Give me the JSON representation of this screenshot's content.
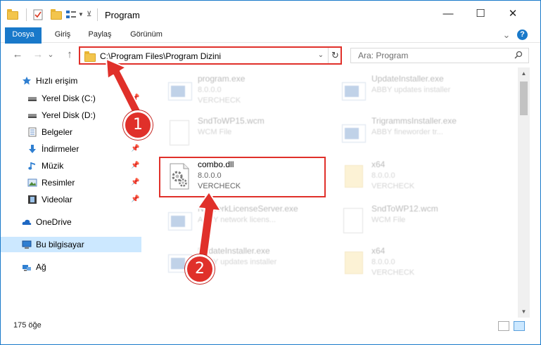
{
  "window": {
    "title": "Program",
    "controls": {
      "minimize": "—",
      "maximize": "☐",
      "close": "✕"
    }
  },
  "ribbon": {
    "tabs": [
      {
        "label": "Dosya"
      },
      {
        "label": "Giriş"
      },
      {
        "label": "Paylaş"
      },
      {
        "label": "Görünüm"
      }
    ],
    "expand": "⌄",
    "help": "?"
  },
  "nav": {
    "back": "←",
    "forward": "→",
    "recent": "⌄",
    "up": "↑",
    "address": "C:\\Program Files\\Program Dizini",
    "address_dropdown": "⌄",
    "refresh": "↻",
    "search_placeholder": "Ara: Program"
  },
  "sidebar": {
    "items": [
      {
        "label": "Hızlı erişim",
        "icon": "star-icon",
        "pinned": false
      },
      {
        "label": "Yerel Disk (C:)",
        "icon": "drive-icon",
        "pinned": true
      },
      {
        "label": "Yerel Disk (D:)",
        "icon": "drive-icon",
        "pinned": true
      },
      {
        "label": "Belgeler",
        "icon": "documents-icon",
        "pinned": true
      },
      {
        "label": "İndirmeler",
        "icon": "download-icon",
        "pinned": true
      },
      {
        "label": "Müzik",
        "icon": "music-icon",
        "pinned": true
      },
      {
        "label": "Resimler",
        "icon": "pictures-icon",
        "pinned": true
      },
      {
        "label": "Videolar",
        "icon": "videos-icon",
        "pinned": true
      },
      {
        "label": "OneDrive",
        "icon": "onedrive-icon",
        "pinned": false
      },
      {
        "label": "Bu bilgisayar",
        "icon": "computer-icon",
        "pinned": false,
        "selected": true
      },
      {
        "label": "Ağ",
        "icon": "network-icon",
        "pinned": false
      }
    ],
    "pin_glyph": "📌"
  },
  "files": [
    {
      "name": "program.exe",
      "version": "8.0.0.0",
      "company": "VERCHECK",
      "icon": "exe-icon",
      "faded": true
    },
    {
      "name": "UpdateInstaller.exe",
      "version": "",
      "company": "ABBY updates installer",
      "icon": "exe-icon",
      "faded": true
    },
    {
      "name": "SndToWP15.wcm",
      "version": "",
      "company": "WCM File",
      "icon": "document-icon",
      "faded": true
    },
    {
      "name": "TrigrammsInstaller.exe",
      "version": "",
      "company": "ABBY fineworder tr...",
      "icon": "exe-icon",
      "faded": true
    },
    {
      "name": "combo.dll",
      "version": "8.0.0.0",
      "company": "VERCHECK",
      "icon": "dll-gear-icon",
      "faded": false
    },
    {
      "name": "x64",
      "version": "8.0.0.0",
      "company": "VERCHECK",
      "icon": "folder-icon",
      "faded": true
    },
    {
      "name": "NetworkLicenseServer.exe",
      "version": "",
      "company": "ABBY network licens...",
      "icon": "exe-icon",
      "faded": true
    },
    {
      "name": "SndToWP12.wcm",
      "version": "",
      "company": "WCM File",
      "icon": "document-icon",
      "faded": true
    },
    {
      "name": "UpdateInstaller.exe",
      "version": "",
      "company": "ABBY updates installer",
      "icon": "exe-icon",
      "faded": true
    },
    {
      "name": "x64",
      "version": "8.0.0.0",
      "company": "VERCHECK",
      "icon": "folder-icon",
      "faded": true
    }
  ],
  "status": {
    "count": "175 öğe"
  },
  "callouts": {
    "one": "1",
    "two": "2"
  },
  "colors": {
    "accent": "#1979ca",
    "callout": "#e0302a",
    "selected": "#cce8ff"
  }
}
